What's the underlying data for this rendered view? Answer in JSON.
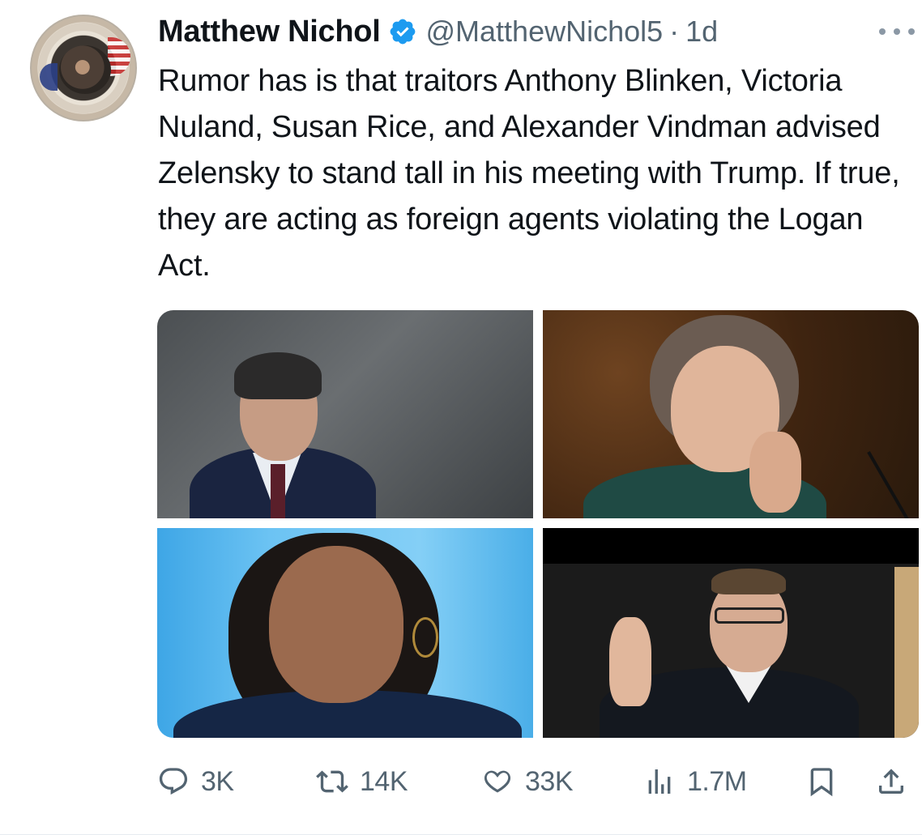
{
  "tweet": {
    "author_name": "Matthew Nichol",
    "handle": "@MatthewNichol5",
    "separator": "·",
    "time": "1d",
    "text": "Rumor has is that traitors Anthony Blinken, Victoria Nuland, Susan Rice, and Alexander Vindman advised Zelensky to stand tall in his meeting with Trump. If true, they are acting as foreign agents violating the Logan Act.",
    "avatar_icon": "american-patriot-seal-avatar",
    "verified_icon": "verified-badge-icon",
    "media_count": 4
  },
  "actions": {
    "replies": "3K",
    "reposts": "14K",
    "likes": "33K",
    "views": "1.7M"
  },
  "colors": {
    "verified": "#1d9bf0",
    "secondary_text": "#536471",
    "primary_text": "#0f1419"
  }
}
